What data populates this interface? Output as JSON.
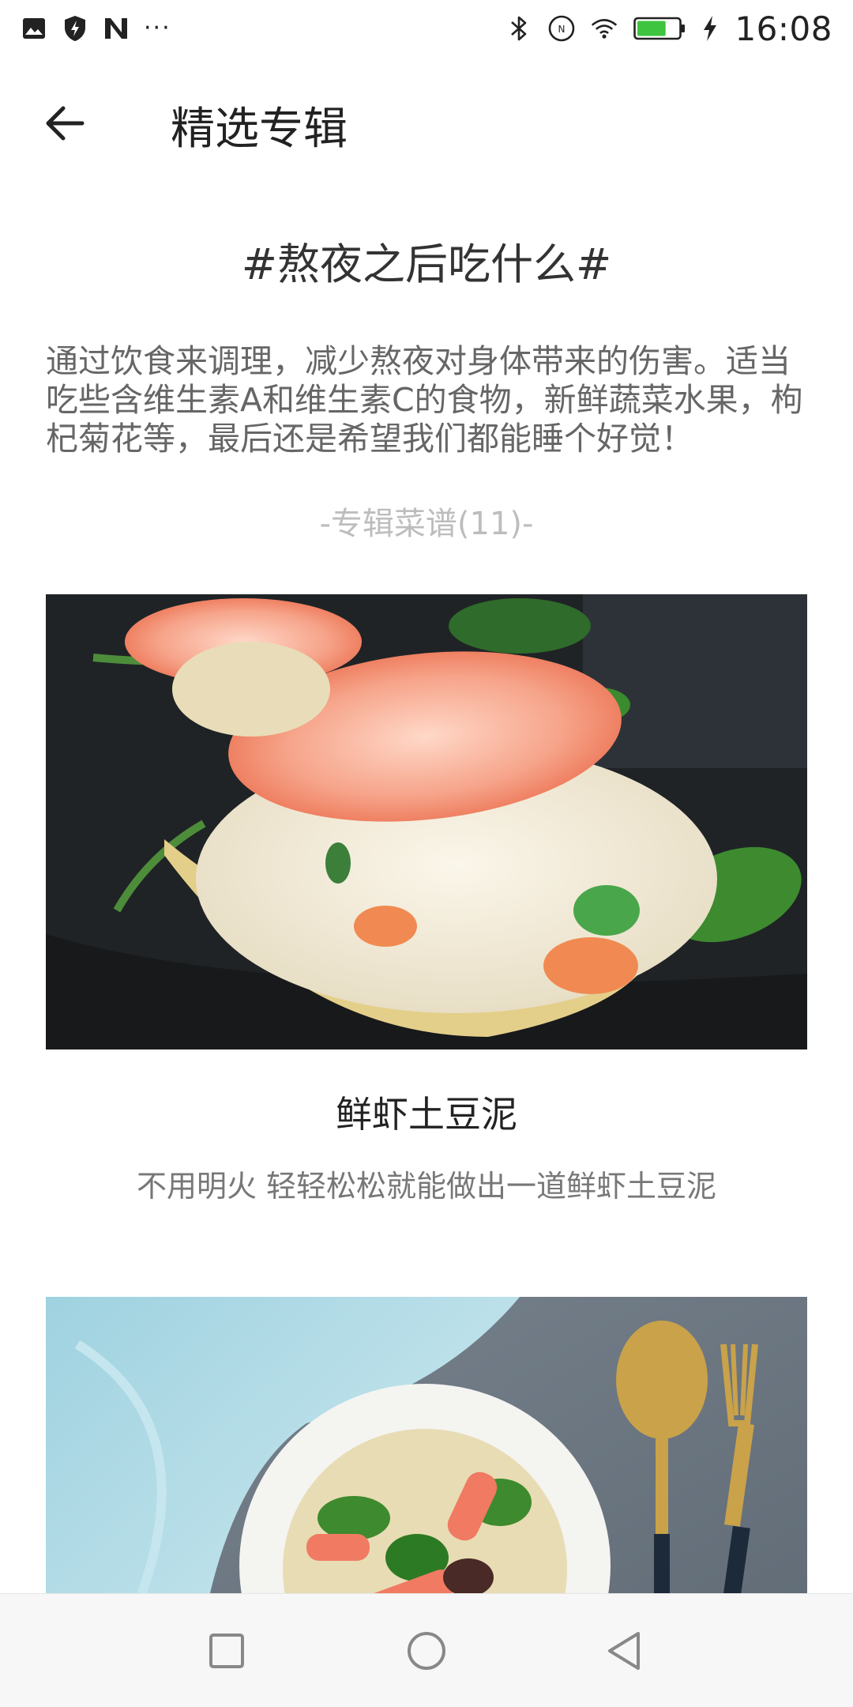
{
  "status_bar": {
    "time": "16:08",
    "left_icons": [
      "gallery-icon",
      "shield-bolt-icon",
      "n-logo-icon"
    ],
    "more": "···",
    "right_icons": [
      "bluetooth-icon",
      "nfc-icon",
      "wifi-icon",
      "battery-icon",
      "charging-icon"
    ],
    "battery_level_percent": 70
  },
  "app_bar": {
    "title": "精选专辑"
  },
  "topic": {
    "title": "#熬夜之后吃什么#",
    "description": "通过饮食来调理，减少熬夜对身体带来的伤害。适当吃些含维生素A和维生素C的食物，新鲜蔬菜水果，枸杞菊花等，最后还是希望我们都能睡个好觉！",
    "recipe_count_label": "-专辑菜谱(11)-"
  },
  "recipes": [
    {
      "title": "鲜虾土豆泥",
      "subtitle": "不用明火 轻轻松松就能做出一道鲜虾土豆泥"
    },
    {
      "title": "",
      "subtitle": ""
    }
  ],
  "colors": {
    "accent_text": "#222222",
    "muted_text": "#777777",
    "count_text": "#bdbdbd",
    "battery_green": "#3ec43e"
  }
}
